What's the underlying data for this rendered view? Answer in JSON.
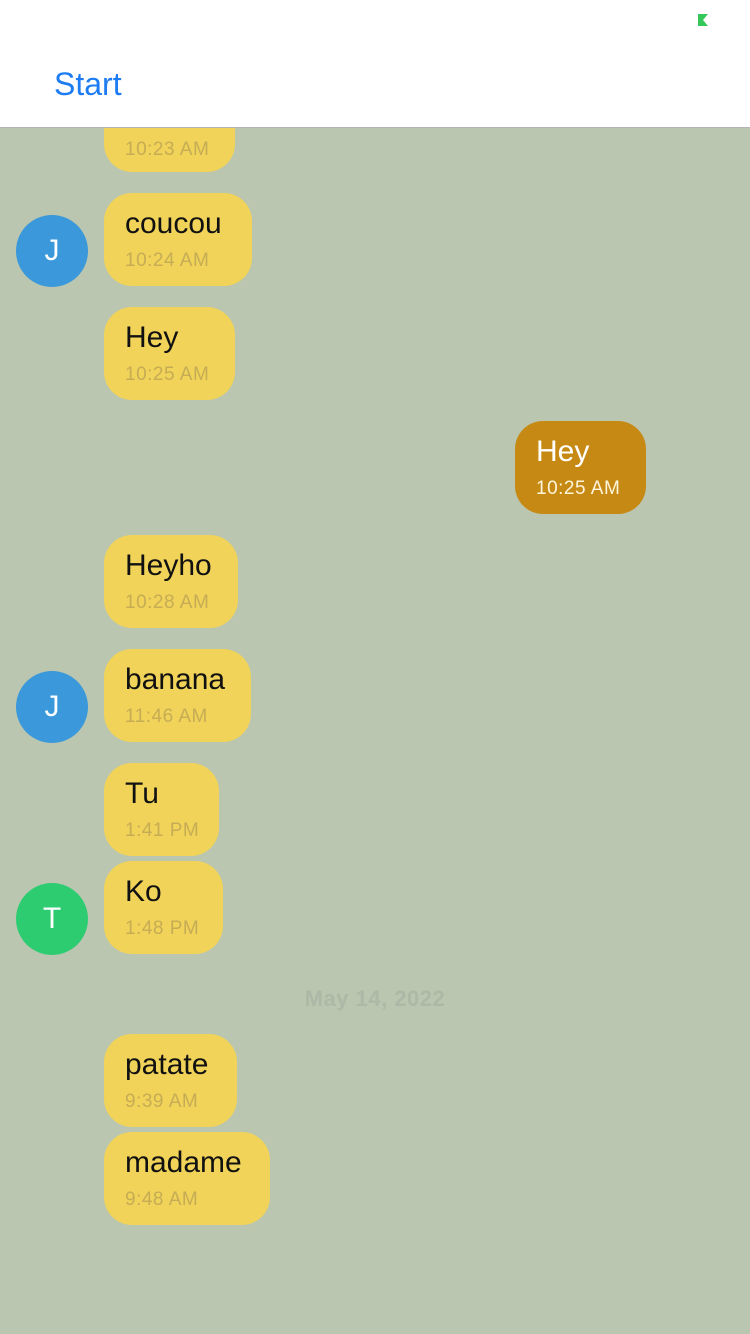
{
  "header": {
    "back_label": "Start",
    "status_icon": "battery-charging-icon",
    "status_color": "#34c759"
  },
  "colors": {
    "background": "#bac6b0",
    "incoming_bubble": "#f0d358",
    "outgoing_bubble": "#c68a14",
    "link": "#1e7cf2"
  },
  "avatars": [
    {
      "initial": "J",
      "color": "#3a98db"
    },
    {
      "initial": "J",
      "color": "#3a98db"
    },
    {
      "initial": "T",
      "color": "#2ecc71"
    }
  ],
  "messages": [
    {
      "text": "",
      "time": "10:23 AM",
      "direction": "incoming"
    },
    {
      "text": "coucou",
      "time": "10:24 AM",
      "direction": "incoming"
    },
    {
      "text": "Hey",
      "time": "10:25 AM",
      "direction": "incoming"
    },
    {
      "text": "Hey",
      "time": "10:25 AM",
      "direction": "outgoing"
    },
    {
      "text": "Heyho",
      "time": "10:28 AM",
      "direction": "incoming"
    },
    {
      "text": "banana",
      "time": "11:46 AM",
      "direction": "incoming"
    },
    {
      "text": "Tu",
      "time": "1:41 PM",
      "direction": "incoming"
    },
    {
      "text": "Ko",
      "time": "1:48 PM",
      "direction": "incoming"
    },
    {
      "text": "patate",
      "time": "9:39 AM",
      "direction": "incoming"
    },
    {
      "text": "madame",
      "time": "9:48 AM",
      "direction": "incoming"
    }
  ],
  "date_separator": "May 14, 2022"
}
